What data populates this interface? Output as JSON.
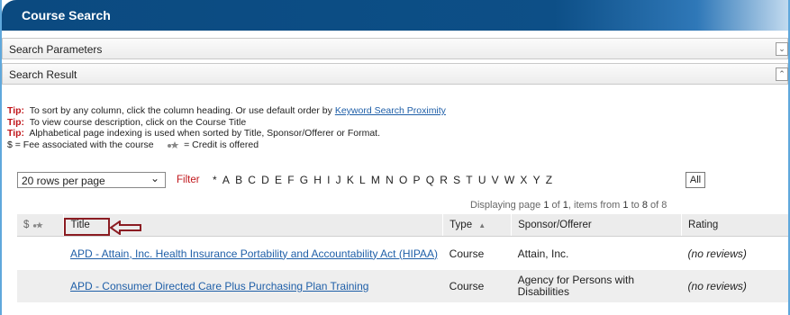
{
  "window": {
    "title": "Course Search"
  },
  "sections": {
    "search_parameters": {
      "label": "Search Parameters",
      "toggle": "⌄"
    },
    "search_result": {
      "label": "Search Result",
      "toggle": "⌃"
    }
  },
  "tips": {
    "label": "Tip:",
    "tip1_text": "To sort by any column, click the column heading. Or use default order by ",
    "tip1_link": "Keyword Search Proximity",
    "tip2_text": "To view course description, click on the Course Title",
    "tip3_text": "Alphabetical page indexing is used when sorted by Title, Sponsor/Offerer or Format.",
    "fee_legend": "$ = Fee associated with the course",
    "credit_legend": "= Credit is offered"
  },
  "toolbar": {
    "rows_per_page": "20 rows per page",
    "filter_label": "Filter",
    "letters": [
      "*",
      "A",
      "B",
      "C",
      "D",
      "E",
      "F",
      "G",
      "H",
      "I",
      "J",
      "K",
      "L",
      "M",
      "N",
      "O",
      "P",
      "Q",
      "R",
      "S",
      "T",
      "U",
      "V",
      "W",
      "X",
      "Y",
      "Z"
    ],
    "all_button": "All"
  },
  "paging": {
    "prefix": "Displaying page ",
    "page": "1",
    "of_text": " of ",
    "total_pages": "1",
    "items_text": ", items from ",
    "from": "1",
    "to_text": " to ",
    "to": "8",
    "of2_text": " of 8"
  },
  "table": {
    "headers": {
      "icons": "$",
      "title": "Title",
      "type": "Type",
      "sort_indicator": "▲",
      "sponsor": "Sponsor/Offerer",
      "rating": "Rating"
    },
    "rows": [
      {
        "title": "APD - Attain, Inc. Health Insurance Portability and Accountability Act (HIPAA)",
        "type": "Course",
        "sponsor": "Attain, Inc.",
        "rating": "(no reviews)"
      },
      {
        "title": "APD - Consumer Directed Care Plus Purchasing Plan Training",
        "type": "Course",
        "sponsor": "Agency for Persons with Disabilities",
        "rating": "(no reviews)"
      }
    ]
  },
  "colors": {
    "title_bar": "#0d4f87",
    "tip_red": "#c0161b",
    "link_blue": "#1f5fa8",
    "highlight_box": "#8b1c22"
  }
}
